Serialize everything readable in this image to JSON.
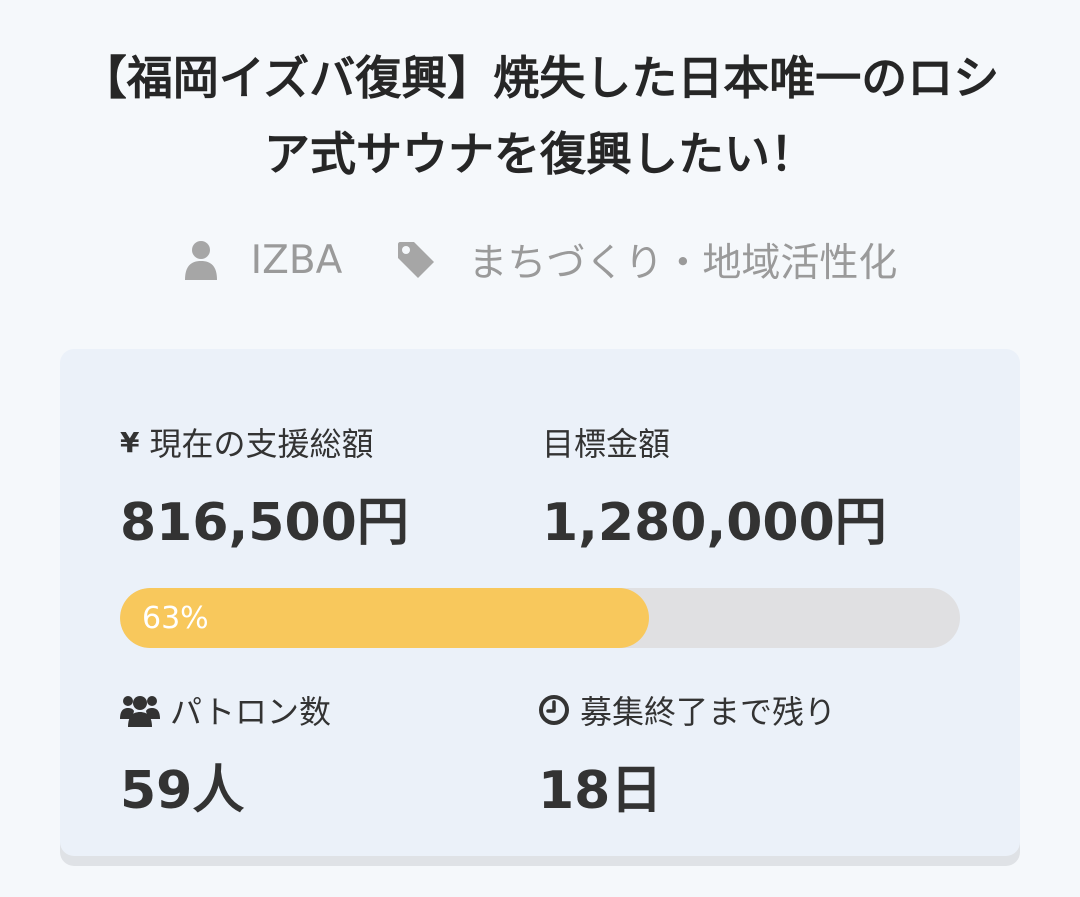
{
  "project": {
    "title": "【福岡イズバ復興】焼失した日本唯一のロシア式サウナを復興したい！",
    "owner": {
      "icon": "user-icon",
      "name": "IZBA"
    },
    "category": {
      "icon": "tag-icon",
      "name": "まちづくり・地域活性化"
    }
  },
  "stats": {
    "current_total": {
      "icon": "yen-icon",
      "icon_glyph": "¥",
      "label": "現在の支援総額",
      "value": "816,500円"
    },
    "goal": {
      "label": "目標金額",
      "value": "1,280,000円"
    },
    "progress": {
      "percent": 63,
      "label": "63%",
      "fill_color": "#f8c85c"
    },
    "patrons": {
      "icon": "users-icon",
      "label": "パトロン数",
      "value": "59人"
    },
    "remaining": {
      "icon": "clock-icon",
      "label": "募集終了まで残り",
      "value": "18日"
    }
  }
}
